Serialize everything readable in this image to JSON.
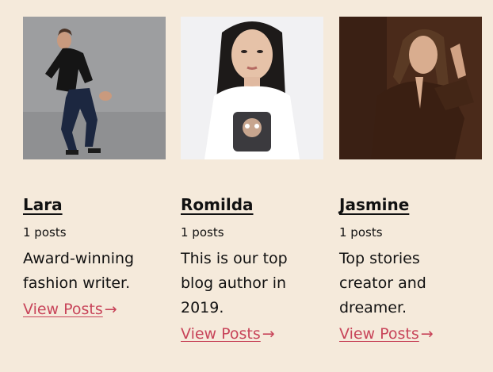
{
  "colors": {
    "background": "#f5eadb",
    "text": "#111111",
    "link": "#c8455a"
  },
  "authors": [
    {
      "name": "Lara",
      "post_count": "1 posts",
      "bio": "Award-winning fashion writer.",
      "link_label": "View Posts",
      "link_icon": "arrow-right-icon"
    },
    {
      "name": "Romilda",
      "post_count": "1 posts",
      "bio": "This is our top blog author in 2019.",
      "link_label": "View Posts",
      "link_icon": "arrow-right-icon"
    },
    {
      "name": "Jasmine",
      "post_count": "1 posts",
      "bio": "Top stories creator and dreamer.",
      "link_label": "View Posts",
      "link_icon": "arrow-right-icon"
    }
  ]
}
